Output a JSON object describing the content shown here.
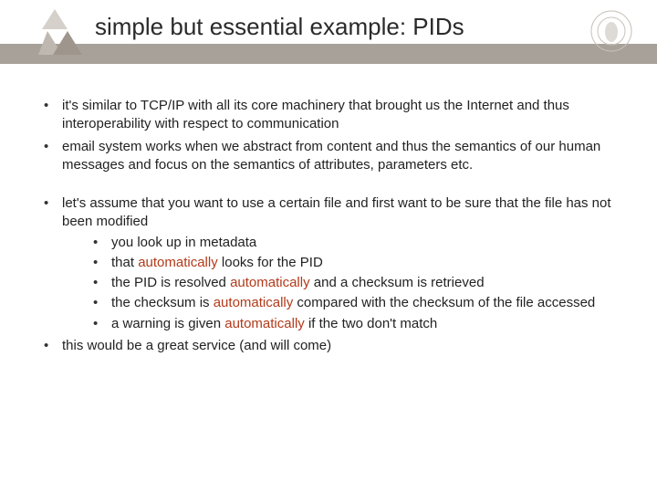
{
  "header": {
    "title": "simple but essential example: PIDs",
    "emblem_label": "MAX-PLANCK-GESELLSCHAFT"
  },
  "bullets": {
    "b1": "it's similar to TCP/IP with all its core machinery that brought us the Internet and thus interoperability with respect to communication",
    "b2": "email system works when we abstract from content and thus the semantics of our human messages and focus on the semantics of attributes, parameters etc.",
    "b3_lead": "let's assume that you want to use a certain file and first want to be sure that the file has not been modified",
    "b3_sub": {
      "s1": "you look up in metadata",
      "s2_a": "that ",
      "s2_b": " looks for the PID",
      "s3_a": "the PID is resolved ",
      "s3_b": " and a checksum is retrieved",
      "s4_a": "the checksum is ",
      "s4_b": " compared with the checksum of the file accessed",
      "s5_a": "a warning is given ",
      "s5_b": " if the two don't match"
    },
    "b4": "this would be a great service (and will come)"
  },
  "keyword": "automatically"
}
